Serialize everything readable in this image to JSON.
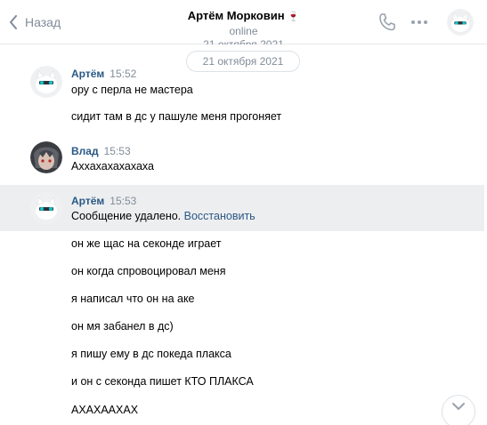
{
  "header": {
    "back_label": "Назад",
    "title": "Артём Морковин",
    "title_emoji": "🍷",
    "status": "online"
  },
  "date_separator": "21 октября 2021",
  "messages": [
    {
      "author": "Артём",
      "time": "15:52",
      "avatar": "cat-avatar",
      "lines": [
        "ору с перла не мастера",
        "сидит там в дс у пашуле меня прогоняет"
      ]
    },
    {
      "author": "Влад",
      "time": "15:53",
      "avatar": "anime-avatar",
      "lines": [
        "Аххахахахахаха"
      ]
    },
    {
      "author": "Артём",
      "time": "15:53",
      "avatar": "cat-avatar",
      "deleted_text": "Сообщение удалено.",
      "restore_label": "Восстановить",
      "lines": [
        "он же щас на секонде играет",
        "он когда спровоцировал меня",
        "я написал что он на аке",
        "он мя забанел в дс)",
        "я пишу ему в дс покеда плакса",
        "и он с секонда пишет КТО ПЛАКСА",
        "АХАХААХАХ"
      ]
    }
  ],
  "colors": {
    "link": "#2a5885",
    "muted": "#818c99",
    "highlight": "#edeef0"
  }
}
